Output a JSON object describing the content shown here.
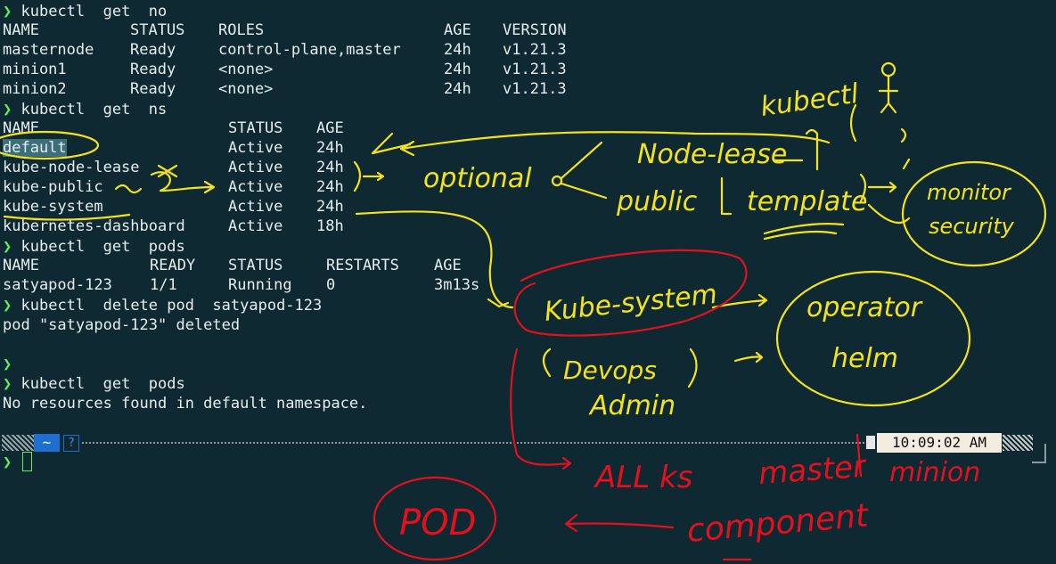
{
  "terminal": {
    "prompt_symbol": "❯",
    "cmd1": "kubectl  get  no",
    "nodes_header": [
      "NAME",
      "STATUS",
      "ROLES",
      "AGE",
      "VERSION"
    ],
    "nodes": [
      [
        "masternode",
        "Ready",
        "control-plane,master",
        "24h",
        "v1.21.3"
      ],
      [
        "minion1",
        "Ready",
        "<none>",
        "24h",
        "v1.21.3"
      ],
      [
        "minion2",
        "Ready",
        "<none>",
        "24h",
        "v1.21.3"
      ]
    ],
    "cmd2": "kubectl  get  ns",
    "ns_header": [
      "NAME",
      "STATUS",
      "AGE"
    ],
    "namespaces": [
      [
        "default",
        "Active",
        "24h"
      ],
      [
        "kube-node-lease",
        "Active",
        "24h"
      ],
      [
        "kube-public",
        "Active",
        "24h"
      ],
      [
        "kube-system",
        "Active",
        "24h"
      ],
      [
        "kubernetes-dashboard",
        "Active",
        "18h"
      ]
    ],
    "cmd3": "kubectl  get  pods",
    "pods_header": [
      "NAME",
      "READY",
      "STATUS",
      "RESTARTS",
      "AGE"
    ],
    "pods": [
      [
        "satyapod-123",
        "1/1",
        "Running",
        "0",
        "3m13s"
      ]
    ],
    "cmd4": "kubectl  delete pod  satyapod-123",
    "delete_output": "pod \"satyapod-123\" deleted",
    "cmd5": "kubectl  get  pods",
    "no_resources": "No resources found in default namespace."
  },
  "statusbar": {
    "home_icon": "~",
    "help_icon": "?",
    "clock": "10:09:02 AM"
  },
  "annotations": {
    "yellow": {
      "kubectl": "kubectl",
      "node_lease": "Node-lease",
      "optional": "optional",
      "public": "public",
      "template": "template",
      "monitor": "monitor",
      "security": "security",
      "kube_system": "Kube-system",
      "devops": "Devops",
      "admin": "Admin",
      "operator": "operator",
      "helm": "helm"
    },
    "red": {
      "all_ks": "ALL ks",
      "master": "master",
      "minion": "minion",
      "pod": "POD",
      "component": "component"
    },
    "colors": {
      "yellow": "#f4e21c",
      "red": "#e3101e"
    }
  }
}
